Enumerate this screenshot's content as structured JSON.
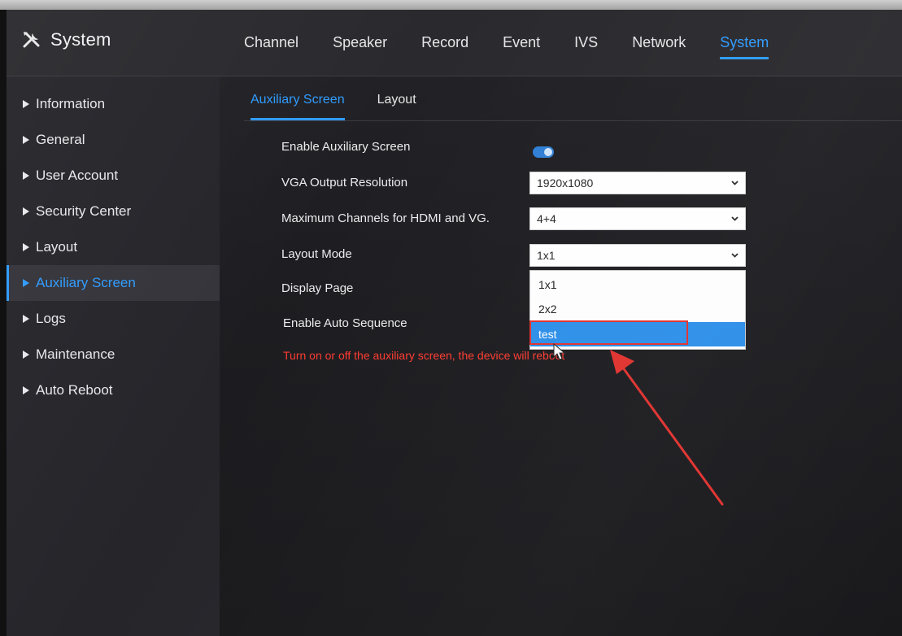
{
  "header": {
    "brand_label": "System",
    "brand_icon": "tools-icon",
    "tabs": [
      {
        "label": "Channel",
        "active": false
      },
      {
        "label": "Speaker",
        "active": false
      },
      {
        "label": "Record",
        "active": false
      },
      {
        "label": "Event",
        "active": false
      },
      {
        "label": "IVS",
        "active": false
      },
      {
        "label": "Network",
        "active": false
      },
      {
        "label": "System",
        "active": true
      }
    ]
  },
  "sidebar": {
    "items": [
      {
        "label": "Information",
        "active": false
      },
      {
        "label": "General",
        "active": false
      },
      {
        "label": "User Account",
        "active": false
      },
      {
        "label": "Security Center",
        "active": false
      },
      {
        "label": "Layout",
        "active": false
      },
      {
        "label": "Auxiliary Screen",
        "active": true
      },
      {
        "label": "Logs",
        "active": false
      },
      {
        "label": "Maintenance",
        "active": false
      },
      {
        "label": "Auto Reboot",
        "active": false
      }
    ]
  },
  "subtabs": [
    {
      "label": "Auxiliary Screen",
      "active": true
    },
    {
      "label": "Layout",
      "active": false
    }
  ],
  "form": {
    "enable_aux_label": "Enable Auxiliary Screen",
    "enable_aux_on": true,
    "vga_label": "VGA Output Resolution",
    "vga_value": "1920x1080",
    "max_channels_label": "Maximum Channels for HDMI and VG.",
    "max_channels_value": "4+4",
    "layout_mode_label": "Layout Mode",
    "layout_mode_value": "1x1",
    "display_page_label": "Display Page",
    "auto_sequence_label": "Enable Auto Sequence",
    "layout_mode_options": [
      "1x1",
      "2x2",
      "test"
    ],
    "highlighted_option": "test",
    "warning": "Turn on or off the auxiliary screen, the device will reboot"
  },
  "colors": {
    "accent": "#2f9bff",
    "warning": "#ff3b30",
    "annotation": "#e0322f",
    "selected_option": "#2d8fe8"
  }
}
